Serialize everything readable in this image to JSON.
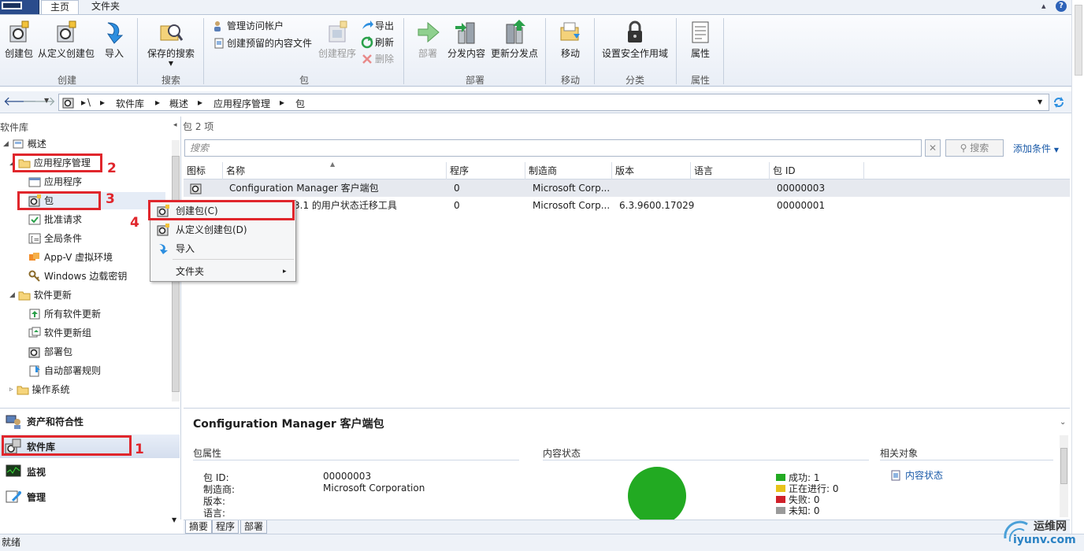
{
  "ribbon": {
    "tabs": [
      {
        "label": "主页",
        "active": true
      },
      {
        "label": "文件夹",
        "active": false
      }
    ],
    "groups": {
      "create": {
        "label": "创建",
        "buttons": [
          "创建包",
          "从定义创建包",
          "导入"
        ]
      },
      "search": {
        "label": "搜索",
        "buttons": [
          "保存的搜索"
        ]
      },
      "package": {
        "label": "包",
        "small": [
          "管理访问帐户",
          "创建预留的内容文件"
        ],
        "create_program": "创建程序",
        "export": "导出",
        "refresh": "刷新",
        "delete": "删除"
      },
      "deploy": {
        "label": "部署",
        "buttons": [
          "部署",
          "分发内容",
          "更新分发点"
        ]
      },
      "move": {
        "label": "移动",
        "buttons": [
          "移动"
        ]
      },
      "classify": {
        "label": "分类",
        "buttons": [
          "设置安全作用域"
        ]
      },
      "properties": {
        "label": "属性",
        "buttons": [
          "属性"
        ]
      }
    }
  },
  "address": {
    "breadcrumbs": [
      "\\",
      "软件库",
      "概述",
      "应用程序管理",
      "包"
    ]
  },
  "left": {
    "title": "软件库",
    "tree": [
      {
        "label": "概述",
        "level": 0
      },
      {
        "label": "应用程序管理",
        "level": 1
      },
      {
        "label": "应用程序",
        "level": 2
      },
      {
        "label": "包",
        "level": 2
      },
      {
        "label": "批准请求",
        "level": 2
      },
      {
        "label": "全局条件",
        "level": 2
      },
      {
        "label": "App-V 虚拟环境",
        "level": 2
      },
      {
        "label": "Windows 边载密钥",
        "level": 2
      },
      {
        "label": "软件更新",
        "level": 1
      },
      {
        "label": "所有软件更新",
        "level": 2
      },
      {
        "label": "软件更新组",
        "level": 2
      },
      {
        "label": "部署包",
        "level": 2
      },
      {
        "label": "自动部署规则",
        "level": 2
      },
      {
        "label": "操作系统",
        "level": 1
      }
    ],
    "nav": [
      "资产和符合性",
      "软件库",
      "监视",
      "管理"
    ]
  },
  "annotations": [
    "1",
    "2",
    "3",
    "4"
  ],
  "list": {
    "header": "包 2 项",
    "search_placeholder": "搜索",
    "search_button": "搜索",
    "add_condition": "添加条件",
    "columns": [
      "图标",
      "名称",
      "程序",
      "制造商",
      "版本",
      "语言",
      "包 ID"
    ],
    "rows": [
      {
        "name": "Configuration Manager 客户端包",
        "programs": "0",
        "manufacturer": "Microsoft Corp...",
        "version": "",
        "language": "",
        "package_id": "00000003"
      },
      {
        "name": "3.1 的用户状态迁移工具",
        "programs": "0",
        "manufacturer": "Microsoft Corp...",
        "version": "6.3.9600.17029",
        "language": "",
        "package_id": "00000001"
      }
    ]
  },
  "context_menu": {
    "items": [
      "创建包(C)",
      "从定义创建包(D)",
      "导入",
      "文件夹"
    ]
  },
  "details": {
    "title": "Configuration Manager 客户端包",
    "sections": [
      "包属性",
      "内容状态",
      "相关对象"
    ],
    "properties": [
      {
        "key": "包 ID:",
        "value": "00000003"
      },
      {
        "key": "制造商:",
        "value": "Microsoft Corporation"
      },
      {
        "key": "版本:",
        "value": ""
      },
      {
        "key": "语言:",
        "value": ""
      }
    ],
    "content_status": {
      "legend": [
        {
          "label": "成功: 1",
          "color": "#22aa22"
        },
        {
          "label": "正在进行: 0",
          "color": "#e8c31a"
        },
        {
          "label": "失败: 0",
          "color": "#d0202a"
        },
        {
          "label": "未知: 0",
          "color": "#9a9a9a"
        }
      ]
    },
    "related": {
      "link": "内容状态"
    }
  },
  "bottom_tabs": [
    {
      "label": "摘要",
      "active": true
    },
    {
      "label": "程序",
      "active": false
    },
    {
      "label": "部署",
      "active": false
    }
  ],
  "status_bar": "就绪",
  "watermark": {
    "line1": "运维网",
    "line2": "iyunv.com"
  }
}
